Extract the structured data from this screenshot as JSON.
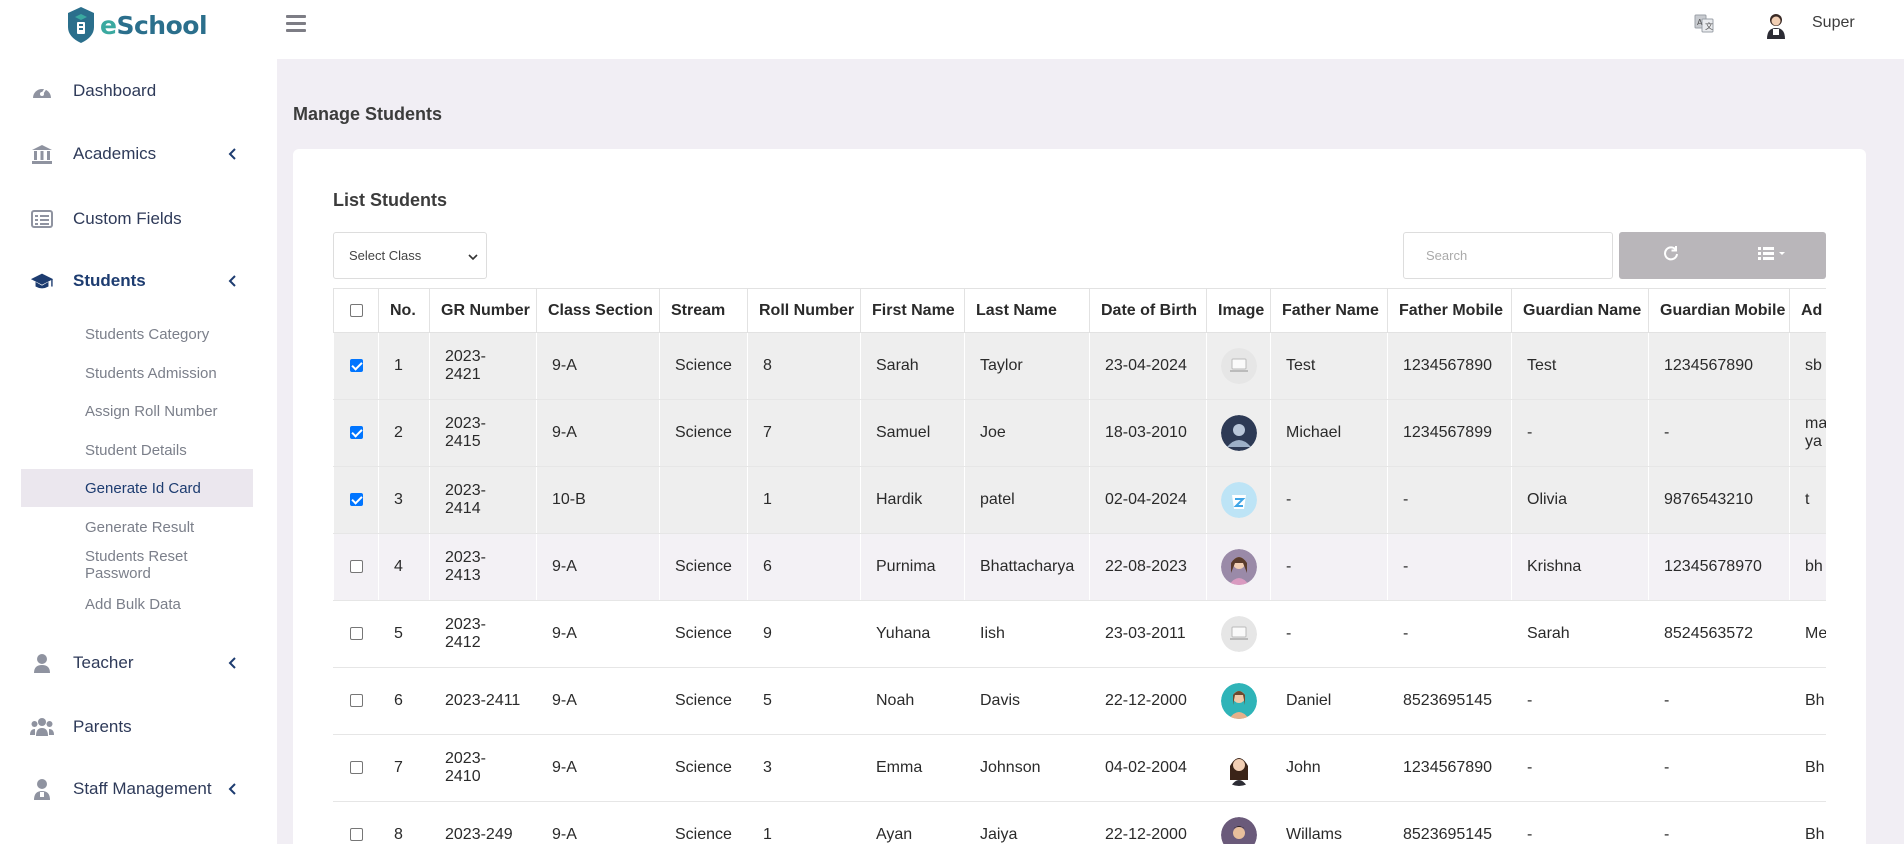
{
  "brand": {
    "name_prefix": "e",
    "name_rest": "School"
  },
  "topbar": {
    "user_name": "Super"
  },
  "sidebar": {
    "items": [
      {
        "label": "Dashboard",
        "icon": "dashboard-icon"
      },
      {
        "label": "Academics",
        "icon": "bank-icon",
        "expandable": true
      },
      {
        "label": "Custom Fields",
        "icon": "list-icon"
      },
      {
        "label": "Students",
        "icon": "graduation-cap-icon",
        "expandable": true,
        "active": true
      },
      {
        "label": "Teacher",
        "icon": "user-icon",
        "expandable": true
      },
      {
        "label": "Parents",
        "icon": "users-icon"
      },
      {
        "label": "Staff Management",
        "icon": "staff-icon",
        "expandable": true
      }
    ],
    "student_sub": [
      "Students Category",
      "Students Admission",
      "Assign Roll Number",
      "Student Details",
      "Generate Id Card",
      "Generate Result",
      "Students Reset Password",
      "Add Bulk Data"
    ],
    "active_sub": "Generate Id Card"
  },
  "page": {
    "title": "Manage Students"
  },
  "card": {
    "title": "List Students",
    "select_class": "Select Class",
    "search_placeholder": "Search"
  },
  "table": {
    "headers": [
      "No.",
      "GR Number",
      "Class Section",
      "Stream",
      "Roll Number",
      "First Name",
      "Last Name",
      "Date of Birth",
      "Image",
      "Father Name",
      "Father Mobile",
      "Guardian Name",
      "Guardian Mobile",
      "Ad"
    ],
    "rows": [
      {
        "checked": true,
        "no": "1",
        "gr": "2023-\n2421",
        "class": "9-A",
        "stream": "Science",
        "roll": "8",
        "first": "Sarah",
        "last": "Taylor",
        "dob": "23-04-2024",
        "image": "placeholder",
        "father": "Test",
        "father_mobile": "1234567890",
        "guardian": "Test",
        "guardian_mobile": "1234567890",
        "address": "sb"
      },
      {
        "checked": true,
        "no": "2",
        "gr": "2023-\n2415",
        "class": "9-A",
        "stream": "Science",
        "roll": "7",
        "first": "Samuel",
        "last": "Joe",
        "dob": "18-03-2010",
        "image": "dark-avatar",
        "father": "Michael",
        "father_mobile": "1234567899",
        "guardian": "-",
        "guardian_mobile": "-",
        "address": "ma\nya"
      },
      {
        "checked": true,
        "no": "3",
        "gr": "2023-\n2414",
        "class": "10-B",
        "stream": "",
        "roll": "1",
        "first": "Hardik",
        "last": "patel",
        "dob": "02-04-2024",
        "image": "blue-logo",
        "father": "-",
        "father_mobile": "-",
        "guardian": "Olivia",
        "guardian_mobile": "9876543210",
        "address": "t"
      },
      {
        "checked": false,
        "no": "4",
        "gr": "2023-\n2413",
        "class": "9-A",
        "stream": "Science",
        "roll": "6",
        "first": "Purnima",
        "last": "Bhattacharya",
        "dob": "22-08-2023",
        "image": "girl-avatar",
        "father": "-",
        "father_mobile": "-",
        "guardian": "Krishna",
        "guardian_mobile": "12345678970",
        "address": "bh"
      },
      {
        "checked": false,
        "no": "5",
        "gr": "2023-\n2412",
        "class": "9-A",
        "stream": "Science",
        "roll": "9",
        "first": "Yuhana",
        "last": "Iish",
        "dob": "23-03-2011",
        "image": "placeholder",
        "father": "-",
        "father_mobile": "-",
        "guardian": "Sarah",
        "guardian_mobile": "8524563572",
        "address": "Me"
      },
      {
        "checked": false,
        "no": "6",
        "gr": "2023-2411",
        "class": "9-A",
        "stream": "Science",
        "roll": "5",
        "first": "Noah",
        "last": "Davis",
        "dob": "22-12-2000",
        "image": "teal-avatar",
        "father": "Daniel",
        "father_mobile": "8523695145",
        "guardian": "-",
        "guardian_mobile": "-",
        "address": "Bh"
      },
      {
        "checked": false,
        "no": "7",
        "gr": "2023-\n2410",
        "class": "9-A",
        "stream": "Science",
        "roll": "3",
        "first": "Emma",
        "last": "Johnson",
        "dob": "04-02-2004",
        "image": "woman-avatar",
        "father": "John",
        "father_mobile": "1234567890",
        "guardian": "-",
        "guardian_mobile": "-",
        "address": "Bh"
      },
      {
        "checked": false,
        "no": "8",
        "gr": "2023-249",
        "class": "9-A",
        "stream": "Science",
        "roll": "1",
        "first": "Ayan",
        "last": "Jaiya",
        "dob": "22-12-2000",
        "image": "boy-avatar",
        "father": "Willams",
        "father_mobile": "8523695145",
        "guardian": "-",
        "guardian_mobile": "-",
        "address": "Bh"
      }
    ]
  },
  "colors": {
    "brand": "#2b6f8c",
    "accent": "#3aa9a0",
    "active_nav": "#1d3c70",
    "checkbox": "#0075ff"
  }
}
